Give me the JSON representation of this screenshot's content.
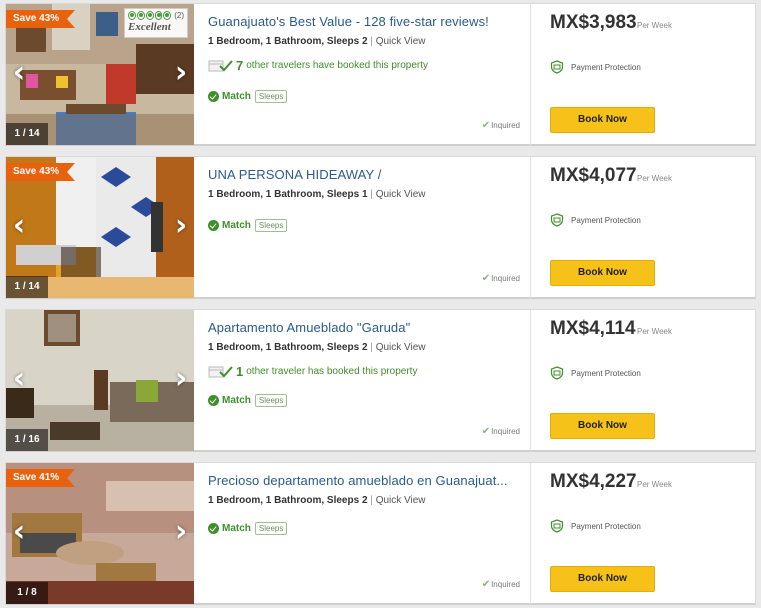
{
  "listings": [
    {
      "save_badge": "Save 43%",
      "photo_counter": "1 / 14",
      "tripadvisor": {
        "count": "(2)",
        "rating": "Excellent",
        "rating_fraction": 1.0
      },
      "title": "Guanajuato's Best Value - 128 five-star reviews!",
      "specs": {
        "bedrooms": "1 Bedroom,",
        "bathrooms": "1 Bathroom,",
        "sleeps": "Sleeps 2",
        "separator": "|",
        "quick_view": "Quick View"
      },
      "booked": {
        "count": "7",
        "text": "other travelers have booked this property"
      },
      "match": "Match",
      "sleeps_tag": "Sleeps",
      "inquired": "Inquired",
      "price": "MX$3,983",
      "per_week": "Per Week",
      "payment_protection": "Payment Protection",
      "book_now": "Book Now"
    },
    {
      "save_badge": "Save 43%",
      "photo_counter": "1 / 14",
      "title": "UNA PERSONA HIDEAWAY /",
      "specs": {
        "bedrooms": "1 Bedroom,",
        "bathrooms": "1 Bathroom,",
        "sleeps": "Sleeps 1",
        "separator": "|",
        "quick_view": "Quick View"
      },
      "match": "Match",
      "sleeps_tag": "Sleeps",
      "inquired": "Inquired",
      "price": "MX$4,077",
      "per_week": "Per Week",
      "payment_protection": "Payment Protection",
      "book_now": "Book Now"
    },
    {
      "photo_counter": "1 / 16",
      "title": "Apartamento Amueblado \"Garuda\"",
      "specs": {
        "bedrooms": "1 Bedroom,",
        "bathrooms": "1 Bathroom,",
        "sleeps": "Sleeps 2",
        "separator": "|",
        "quick_view": "Quick View"
      },
      "booked": {
        "count": "1",
        "text": "other traveler has booked this property"
      },
      "match": "Match",
      "sleeps_tag": "Sleeps",
      "inquired": "Inquired",
      "price": "MX$4,114",
      "per_week": "Per Week",
      "payment_protection": "Payment Protection",
      "book_now": "Book Now"
    },
    {
      "save_badge": "Save 41%",
      "photo_counter": "1 / 8",
      "title": "Precioso departamento amueblado en Guanajuat...",
      "specs": {
        "bedrooms": "1 Bedroom,",
        "bathrooms": "1 Bathroom,",
        "sleeps": "Sleeps 2",
        "separator": "|",
        "quick_view": "Quick View"
      },
      "match": "Match",
      "sleeps_tag": "Sleeps",
      "inquired": "Inquired",
      "price": "MX$4,227",
      "per_week": "Per Week",
      "payment_protection": "Payment Protection",
      "book_now": "Book Now"
    }
  ],
  "icons": {
    "prev_photo": "chevron-left-icon",
    "next_photo": "chevron-right-icon",
    "match": "check-circle-icon",
    "inquired": "checkmark-icon",
    "booked": "calendar-check-icon",
    "payment_protection": "shield-icon"
  },
  "colors": {
    "accent_orange": "#e8610d",
    "title_blue": "#2a5b8c",
    "match_green": "#3f8f2a",
    "book_button": "#f6c21a"
  }
}
